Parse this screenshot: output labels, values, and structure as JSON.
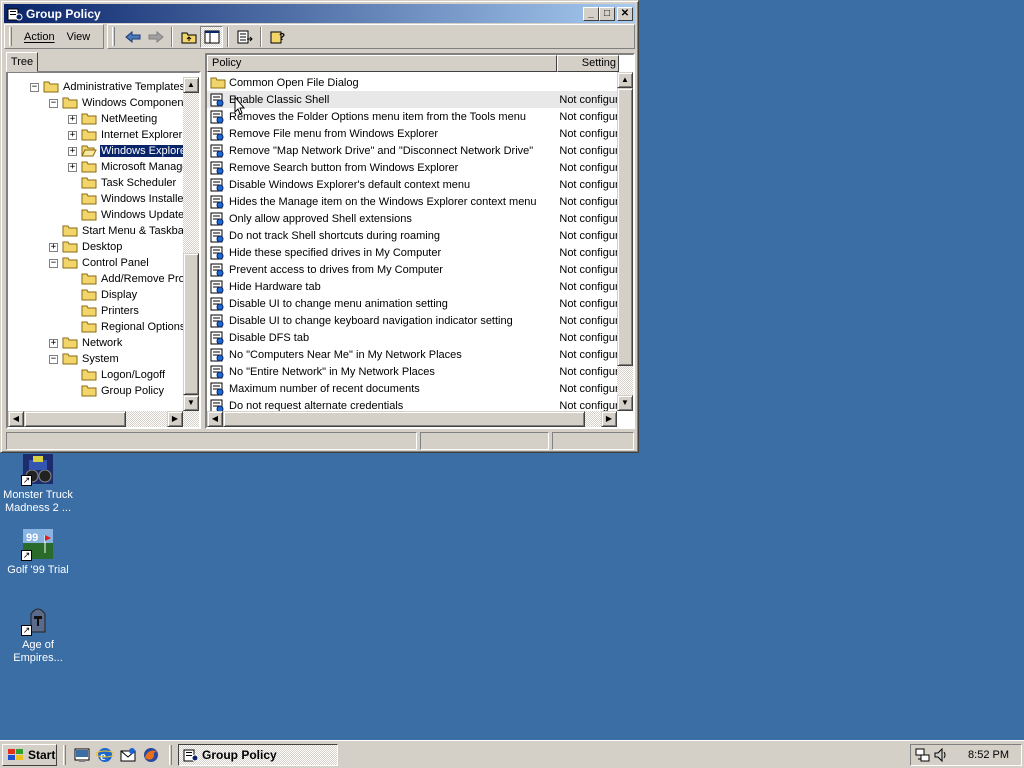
{
  "window": {
    "title": "Group Policy",
    "minimize_label": "_",
    "maximize_label": "□",
    "close_label": "✕"
  },
  "menubar": {
    "action": "Action",
    "view": "View"
  },
  "tree_tab": "Tree",
  "tree": [
    {
      "label": "Administrative Templates",
      "expander": "−",
      "level": 1
    },
    {
      "label": "Windows Components",
      "expander": "−",
      "level": 2
    },
    {
      "label": "NetMeeting",
      "expander": "+",
      "level": 3
    },
    {
      "label": "Internet Explorer",
      "expander": "+",
      "level": 3
    },
    {
      "label": "Windows Explorer",
      "expander": "+",
      "level": 3,
      "selected": true
    },
    {
      "label": "Microsoft Management Console",
      "expander": "+",
      "level": 3
    },
    {
      "label": "Task Scheduler",
      "expander": "",
      "level": 3
    },
    {
      "label": "Windows Installer",
      "expander": "",
      "level": 3
    },
    {
      "label": "Windows Update",
      "expander": "",
      "level": 3
    },
    {
      "label": "Start Menu & Taskbar",
      "expander": "",
      "level": 2
    },
    {
      "label": "Desktop",
      "expander": "+",
      "level": 2
    },
    {
      "label": "Control Panel",
      "expander": "−",
      "level": 2
    },
    {
      "label": "Add/Remove Programs",
      "expander": "",
      "level": 3
    },
    {
      "label": "Display",
      "expander": "",
      "level": 3
    },
    {
      "label": "Printers",
      "expander": "",
      "level": 3
    },
    {
      "label": "Regional Options",
      "expander": "",
      "level": 3
    },
    {
      "label": "Network",
      "expander": "+",
      "level": 2
    },
    {
      "label": "System",
      "expander": "−",
      "level": 2
    },
    {
      "label": "Logon/Logoff",
      "expander": "",
      "level": 3
    },
    {
      "label": "Group Policy",
      "expander": "",
      "level": 3
    }
  ],
  "list": {
    "col_policy": "Policy",
    "col_setting": "Setting",
    "folder_row": "Common Open File Dialog",
    "rows": [
      {
        "name": "Enable Classic Shell",
        "setting": "Not configured"
      },
      {
        "name": "Removes the Folder Options menu item from the Tools menu",
        "setting": "Not configured"
      },
      {
        "name": "Remove File menu from Windows Explorer",
        "setting": "Not configured"
      },
      {
        "name": "Remove \"Map Network Drive\" and \"Disconnect Network Drive\"",
        "setting": "Not configured"
      },
      {
        "name": "Remove Search button from Windows Explorer",
        "setting": "Not configured"
      },
      {
        "name": "Disable Windows Explorer's default context menu",
        "setting": "Not configured"
      },
      {
        "name": "Hides the Manage item on the Windows Explorer context menu",
        "setting": "Not configured"
      },
      {
        "name": "Only allow approved Shell extensions",
        "setting": "Not configured"
      },
      {
        "name": "Do not track Shell shortcuts during roaming",
        "setting": "Not configured"
      },
      {
        "name": "Hide these specified drives in My Computer",
        "setting": "Not configured"
      },
      {
        "name": "Prevent access to drives from My Computer",
        "setting": "Not configured"
      },
      {
        "name": "Hide Hardware tab",
        "setting": "Not configured"
      },
      {
        "name": "Disable UI to change menu animation setting",
        "setting": "Not configured"
      },
      {
        "name": "Disable UI to change keyboard navigation indicator setting",
        "setting": "Not configured"
      },
      {
        "name": "Disable DFS tab",
        "setting": "Not configured"
      },
      {
        "name": "No \"Computers Near Me\" in My Network Places",
        "setting": "Not configured"
      },
      {
        "name": "No \"Entire Network\" in My Network Places",
        "setting": "Not configured"
      },
      {
        "name": "Maximum number of recent documents",
        "setting": "Not configured"
      },
      {
        "name": "Do not request alternate credentials",
        "setting": "Not configured"
      }
    ]
  },
  "desktop_icons": [
    {
      "label_line1": "Monster Truck",
      "label_line2": "Madness 2 ..."
    },
    {
      "label_line1": "Golf '99 Trial",
      "label_line2": ""
    },
    {
      "label_line1": "Age of",
      "label_line2": "Empires..."
    }
  ],
  "taskbar": {
    "start_label": "Start",
    "task_label": "Group Policy",
    "clock": "8:52 PM"
  },
  "colors": {
    "desktop": "#3a6ea5",
    "titlebar_start": "#0a246a",
    "titlebar_end": "#a6caf0",
    "selection": "#0a246a"
  }
}
